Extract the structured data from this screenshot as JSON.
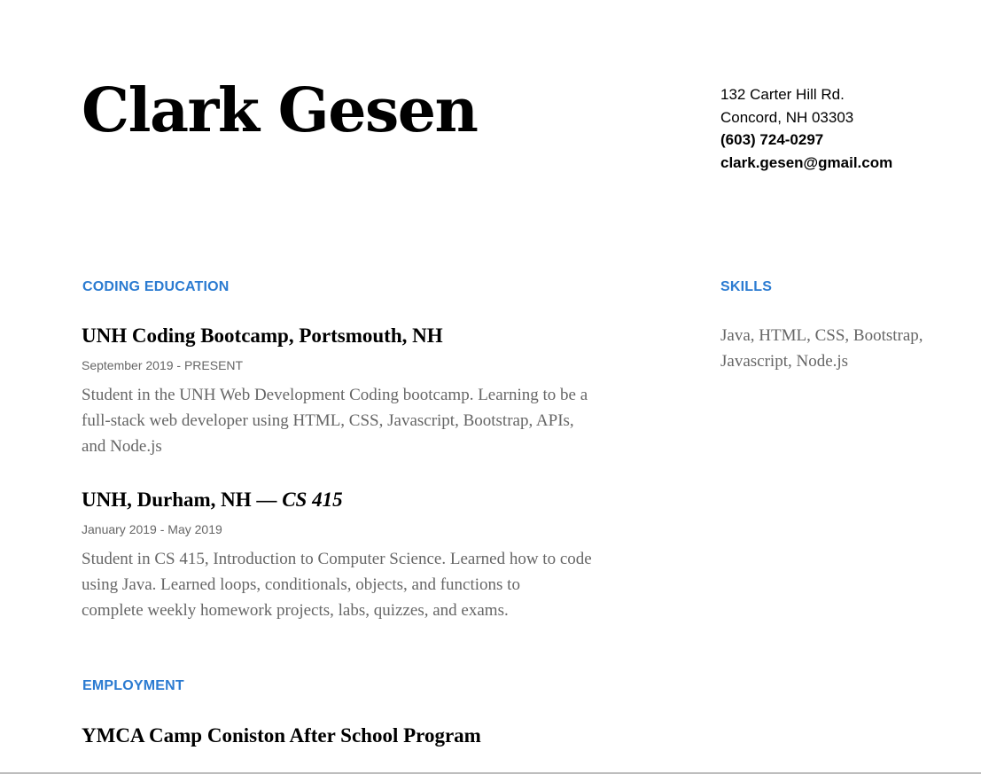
{
  "header": {
    "name": "Clark Gesen",
    "contact": {
      "address_line1": "132 Carter Hill Rd.",
      "address_line2": "Concord, NH 03303",
      "phone": "(603) 724-0297",
      "email": "clark.gesen@gmail.com"
    }
  },
  "coding_education": {
    "title": "CODING EDUCATION",
    "entries": [
      {
        "org": "UNH Coding Bootcamp,",
        "location": " Portsmouth, NH",
        "course": "",
        "dates": "September 2019 - PRESENT",
        "description_lines": [
          "Student in the UNH Web Development Coding bootcamp. Learning to be a",
          "full-stack web developer using HTML, CSS, Javascript, Bootstrap, APIs,",
          "and Node.js"
        ]
      },
      {
        "org": "UNH,",
        "location": " Durham, NH — ",
        "course": "CS 415",
        "dates": "January 2019 - May 2019",
        "description_lines": [
          "Student in CS 415, Introduction to Computer Science. Learned how to code",
          "using Java. Learned loops, conditionals, objects,  and functions to",
          "complete weekly homework projects, labs, quizzes, and exams."
        ]
      }
    ]
  },
  "skills": {
    "title": "SKILLS",
    "lines": [
      "Java, HTML, CSS, Bootstrap,",
      "Javascript, Node.js"
    ]
  },
  "employment": {
    "title": "EMPLOYMENT",
    "entries": [
      {
        "org": "YMCA Camp Coniston After School Program"
      }
    ]
  },
  "colors": {
    "accent": "#2b7bd1",
    "muted_text": "#666666",
    "text": "#000000"
  }
}
